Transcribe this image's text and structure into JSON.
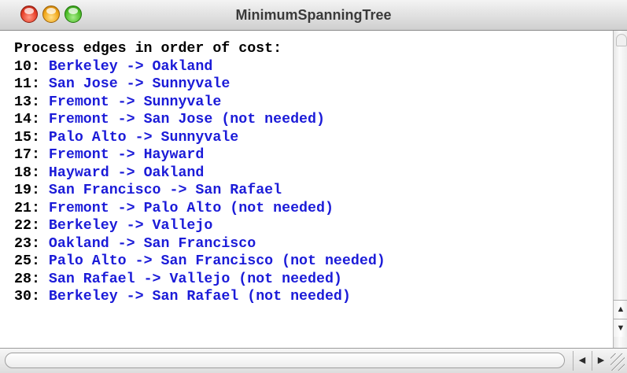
{
  "window": {
    "title": "MinimumSpanningTree"
  },
  "console": {
    "header": "Process edges in order of cost:",
    "lines": [
      {
        "cost": "10:",
        "edge": "Berkeley -> Oakland"
      },
      {
        "cost": "11:",
        "edge": "San Jose -> Sunnyvale"
      },
      {
        "cost": "13:",
        "edge": "Fremont -> Sunnyvale"
      },
      {
        "cost": "14:",
        "edge": "Fremont -> San Jose (not needed)"
      },
      {
        "cost": "15:",
        "edge": "Palo Alto -> Sunnyvale"
      },
      {
        "cost": "17:",
        "edge": "Fremont -> Hayward"
      },
      {
        "cost": "18:",
        "edge": "Hayward -> Oakland"
      },
      {
        "cost": "19:",
        "edge": "San Francisco -> San Rafael"
      },
      {
        "cost": "21:",
        "edge": "Fremont -> Palo Alto (not needed)"
      },
      {
        "cost": "22:",
        "edge": "Berkeley -> Vallejo"
      },
      {
        "cost": "23:",
        "edge": "Oakland -> San Francisco"
      },
      {
        "cost": "25:",
        "edge": "Palo Alto -> San Francisco (not needed)"
      },
      {
        "cost": "28:",
        "edge": "San Rafael -> Vallejo (not needed)"
      },
      {
        "cost": "30:",
        "edge": "Berkeley -> San Rafael (not needed)"
      }
    ]
  },
  "colors": {
    "edge_text": "#1b1bd8",
    "cost_text": "#000000"
  },
  "icons": {
    "close": "close-icon",
    "minimize": "minimize-icon",
    "zoom": "zoom-icon",
    "scroll_up": "arrow-up-icon",
    "scroll_down": "arrow-down-icon",
    "scroll_left": "arrow-left-icon",
    "scroll_right": "arrow-right-icon",
    "resize": "resize-grip-icon"
  }
}
